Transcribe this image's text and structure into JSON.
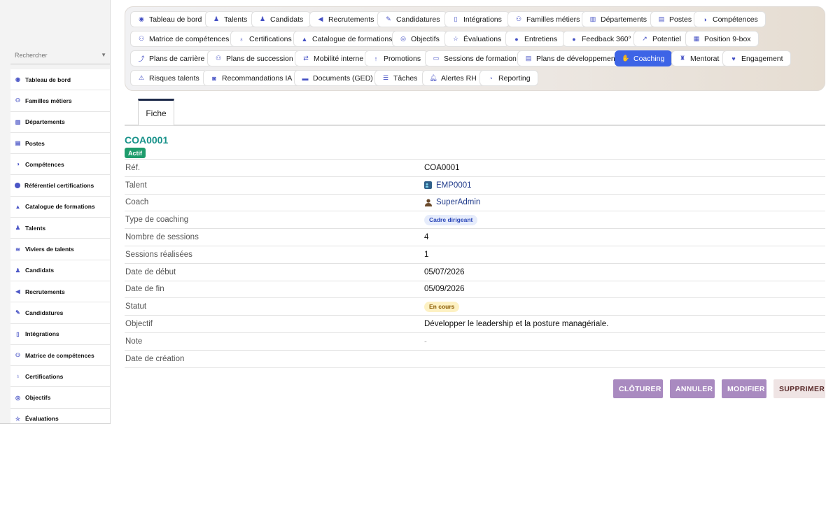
{
  "search": {
    "placeholder": "Rechercher"
  },
  "sidebar": {
    "items": [
      {
        "label": "Tableau de bord",
        "icon": "dashboard-icon"
      },
      {
        "label": "Familles métiers",
        "icon": "sitemap-icon"
      },
      {
        "label": "Départements",
        "icon": "building-icon"
      },
      {
        "label": "Postes",
        "icon": "badge-icon"
      },
      {
        "label": "Compétences",
        "icon": "brain-icon"
      },
      {
        "label": "Référentiel certifications",
        "icon": "certificate-icon"
      },
      {
        "label": "Catalogue de formations",
        "icon": "graduation-cap-icon"
      },
      {
        "label": "Talents",
        "icon": "user-icon"
      },
      {
        "label": "Viviers de talents",
        "icon": "layers-icon"
      },
      {
        "label": "Candidats",
        "icon": "user-plus-icon"
      },
      {
        "label": "Recrutements",
        "icon": "megaphone-icon"
      },
      {
        "label": "Candidatures",
        "icon": "file-signature-icon"
      },
      {
        "label": "Intégrations",
        "icon": "door-icon"
      },
      {
        "label": "Matrice de compétences",
        "icon": "matrix-icon"
      },
      {
        "label": "Certifications",
        "icon": "award-icon"
      },
      {
        "label": "Objectifs",
        "icon": "target-icon"
      },
      {
        "label": "Évaluations",
        "icon": "star-icon"
      }
    ]
  },
  "topnav": {
    "active": "Coaching",
    "items": [
      {
        "label": "Tableau de bord",
        "icon": "dashboard-icon"
      },
      {
        "label": "Talents",
        "icon": "user-icon"
      },
      {
        "label": "Candidats",
        "icon": "user-plus-icon"
      },
      {
        "label": "Recrutements",
        "icon": "megaphone-icon"
      },
      {
        "label": "Candidatures",
        "icon": "file-signature-icon"
      },
      {
        "label": "Intégrations",
        "icon": "door-icon"
      },
      {
        "label": "Familles métiers",
        "icon": "sitemap-icon"
      },
      {
        "label": "Départements",
        "icon": "building-icon"
      },
      {
        "label": "Postes",
        "icon": "badge-icon"
      },
      {
        "label": "Compétences",
        "icon": "brain-icon"
      },
      {
        "label": "Matrice de compétences",
        "icon": "matrix-icon"
      },
      {
        "label": "Certifications",
        "icon": "award-icon"
      },
      {
        "label": "Catalogue de formations",
        "icon": "graduation-cap-icon"
      },
      {
        "label": "Objectifs",
        "icon": "target-icon"
      },
      {
        "label": "Évaluations",
        "icon": "star-icon"
      },
      {
        "label": "Entretiens",
        "icon": "comments-icon"
      },
      {
        "label": "Feedback 360°",
        "icon": "comment-icon"
      },
      {
        "label": "Potentiel",
        "icon": "chart-line-icon"
      },
      {
        "label": "Position 9-box",
        "icon": "grid-icon"
      },
      {
        "label": "Plans de carrière",
        "icon": "route-icon"
      },
      {
        "label": "Plans de succession",
        "icon": "sitemap-icon"
      },
      {
        "label": "Mobilité interne",
        "icon": "exchange-icon"
      },
      {
        "label": "Promotions",
        "icon": "arrow-up-icon"
      },
      {
        "label": "Sessions de formation",
        "icon": "chalkboard-icon"
      },
      {
        "label": "Plans de développement",
        "icon": "clipboard-icon"
      },
      {
        "label": "Coaching",
        "icon": "handshake-icon"
      },
      {
        "label": "Mentorat",
        "icon": "mentor-icon"
      },
      {
        "label": "Engagement",
        "icon": "heart-icon"
      },
      {
        "label": "Risques talents",
        "icon": "warning-icon"
      },
      {
        "label": "Recommandations IA",
        "icon": "robot-icon"
      },
      {
        "label": "Documents (GED)",
        "icon": "folder-icon"
      },
      {
        "label": "Tâches",
        "icon": "tasks-icon"
      },
      {
        "label": "Alertes RH",
        "icon": "bell-icon"
      },
      {
        "label": "Reporting",
        "icon": "pie-chart-icon"
      }
    ]
  },
  "tab": {
    "label": "Fiche"
  },
  "record": {
    "id": "COA0001",
    "status_badge": "Actif",
    "fields": {
      "ref": {
        "label": "Réf.",
        "value": "COA0001"
      },
      "talent": {
        "label": "Talent",
        "value": "EMP0001",
        "icon": "id-card-icon"
      },
      "coach": {
        "label": "Coach",
        "value": "SuperAdmin",
        "icon": "user-tie-icon"
      },
      "type": {
        "label": "Type de coaching",
        "value": "Cadre dirigeant"
      },
      "nb_sessions": {
        "label": "Nombre de sessions",
        "value": "4"
      },
      "sessions_done": {
        "label": "Sessions réalisées",
        "value": "1"
      },
      "start": {
        "label": "Date de début",
        "value": "05/07/2026"
      },
      "end": {
        "label": "Date de fin",
        "value": "05/09/2026"
      },
      "status": {
        "label": "Statut",
        "value": "En cours"
      },
      "objective": {
        "label": "Objectif",
        "value": "Développer le leadership et la posture managériale."
      },
      "note": {
        "label": "Note",
        "value": "-"
      },
      "created": {
        "label": "Date de création",
        "value": ""
      }
    }
  },
  "actions": {
    "close": "CLÔTURER",
    "cancel": "ANNULER",
    "edit": "MODIFIER",
    "delete": "SUPPRIMER"
  },
  "colors": {
    "accent": "#3d64e6",
    "record_id": "#18928a",
    "status_actif": "#1e9c6c",
    "action_button": "#a98ac0"
  }
}
